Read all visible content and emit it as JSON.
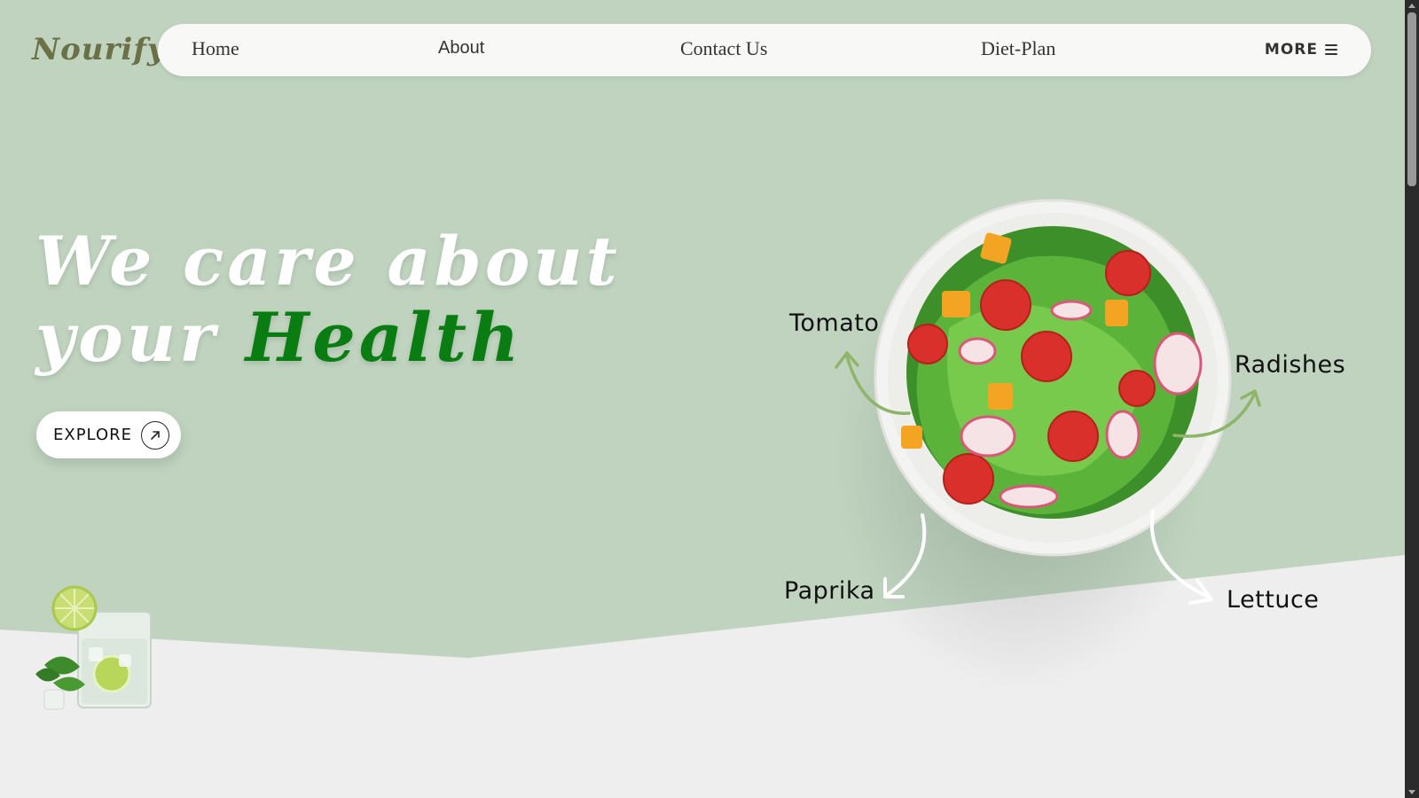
{
  "brand": {
    "logo": "Nourify"
  },
  "nav": {
    "items": [
      "Home",
      "About",
      "Contact Us",
      "Diet-Plan"
    ],
    "more_label": "MORE"
  },
  "hero": {
    "line1": "We care about",
    "line2_prefix": "your ",
    "line2_accent": "Health",
    "cta_label": "EXPLORE",
    "cta_icon": "arrow-up-right-icon"
  },
  "ingredients": {
    "tomato": "Tomato",
    "radishes": "Radishes",
    "paprika": "Paprika",
    "lettuce": "Lettuce"
  },
  "colors": {
    "hero_bg": "#bfd3bf",
    "lower_bg": "#eeeeee",
    "accent_green": "#0a7d12",
    "arrow_green": "#8fb56a",
    "logo": "#6b7046"
  }
}
